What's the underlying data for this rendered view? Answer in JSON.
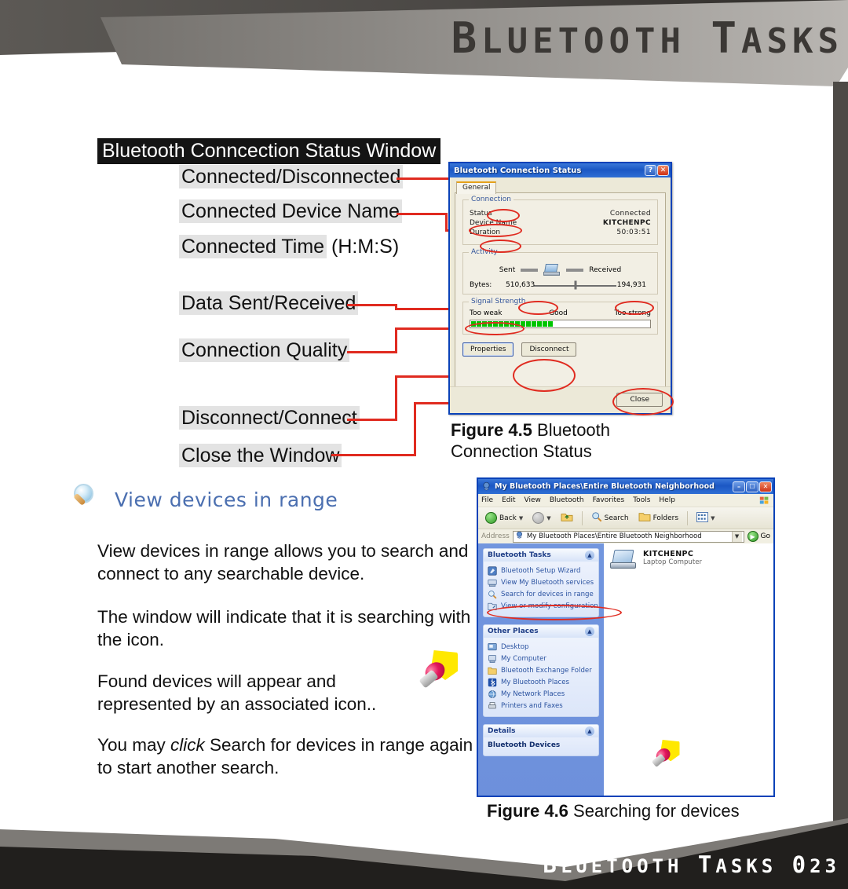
{
  "page": {
    "header_title": "Bluetooth Tasks",
    "footer_text": "Bluetooth Tasks 023"
  },
  "callouts": {
    "section_title": "Bluetooth Conncection Status Window",
    "items": [
      {
        "label": "Connected/Disconnected"
      },
      {
        "label": "Connected Device Name"
      },
      {
        "label": "Connected Time",
        "suffix": "(H:M:S)"
      },
      {
        "label": "Data Sent/Received"
      },
      {
        "label": "Connection Quality"
      },
      {
        "label": "Disconnect/Connect"
      },
      {
        "label": "Close the Window"
      }
    ]
  },
  "status_dialog": {
    "title": "Bluetooth Connection Status",
    "help_button": "?",
    "close_button": "✕",
    "tab": "General",
    "connection_group": "Connection",
    "rows": [
      {
        "key": "Status",
        "value": "Connected"
      },
      {
        "key": "Device Name",
        "value": "KITCHENPC"
      },
      {
        "key": "Duration",
        "value": "50:03:51"
      }
    ],
    "activity_group": "Activity",
    "sent_label": "Sent",
    "received_label": "Received",
    "bytes_label": "Bytes:",
    "bytes_sent": "510,633",
    "bytes_received": "194,931",
    "signal_group": "Signal Strength",
    "signal_too_weak": "Too weak",
    "signal_good": "Good",
    "signal_too_strong": "Too strong",
    "signal_segments": 22,
    "signal_filled": 15,
    "properties_button": "Properties",
    "disconnect_button": "Disconnect",
    "close_window_button": "Close"
  },
  "figure_45": {
    "label": "Figure 4.5",
    "text": "Bluetooth Connection Status"
  },
  "view_devices": {
    "heading": "View devices in range",
    "icon": "magnifier-icon",
    "paragraphs": [
      "View devices in range allows you to search and connect to any searchable device.",
      "The window will indicate that it is searching with the icon.",
      "Found devices will appear and represented by an associated icon..",
      "You may click Search for devices in range again to start another search."
    ],
    "p4_pre": "You may ",
    "p4_em": "click",
    "p4_post": " Search for devices in range again to start another search."
  },
  "explorer": {
    "title": "My Bluetooth Places\\Entire Bluetooth Neighborhood",
    "minimize": "–",
    "maximize": "☐",
    "close": "✕",
    "menu": [
      "File",
      "Edit",
      "View",
      "Bluetooth",
      "Favorites",
      "Tools",
      "Help"
    ],
    "toolbar": {
      "back": "Back",
      "forward": "",
      "up": "",
      "search": "Search",
      "folders": "Folders",
      "views": ""
    },
    "address_label": "Address",
    "address_value": "My Bluetooth Places\\Entire Bluetooth Neighborhood",
    "go_label": "Go",
    "tasks_panel": {
      "title": "Bluetooth Tasks",
      "items": [
        {
          "label": "Bluetooth Setup Wizard",
          "icon": "wizard-icon"
        },
        {
          "label": "View My Bluetooth services",
          "icon": "services-icon"
        },
        {
          "label": "Search for devices in range",
          "icon": "magnifier-icon"
        },
        {
          "label": "View or modify configuration",
          "icon": "config-icon"
        }
      ]
    },
    "other_places_panel": {
      "title": "Other Places",
      "items": [
        {
          "label": "Desktop",
          "icon": "desktop-icon"
        },
        {
          "label": "My Computer",
          "icon": "computer-icon"
        },
        {
          "label": "Bluetooth Exchange Folder",
          "icon": "folder-icon"
        },
        {
          "label": "My Bluetooth Places",
          "icon": "bluetooth-icon"
        },
        {
          "label": "My Network Places",
          "icon": "network-icon"
        },
        {
          "label": "Printers and Faxes",
          "icon": "printer-icon"
        }
      ]
    },
    "details_panel": {
      "title": "Details",
      "text": "Bluetooth Devices"
    },
    "device": {
      "name": "KITCHENPC",
      "type": "Laptop Computer",
      "icon": "laptop-icon"
    }
  },
  "figure_46": {
    "label": "Figure 4.6",
    "text": "Searching for devices"
  },
  "colors": {
    "annotation_red": "#e02b20",
    "xp_title_blue": "#1b57c4",
    "highlight_gray": "#e3e3e3"
  }
}
